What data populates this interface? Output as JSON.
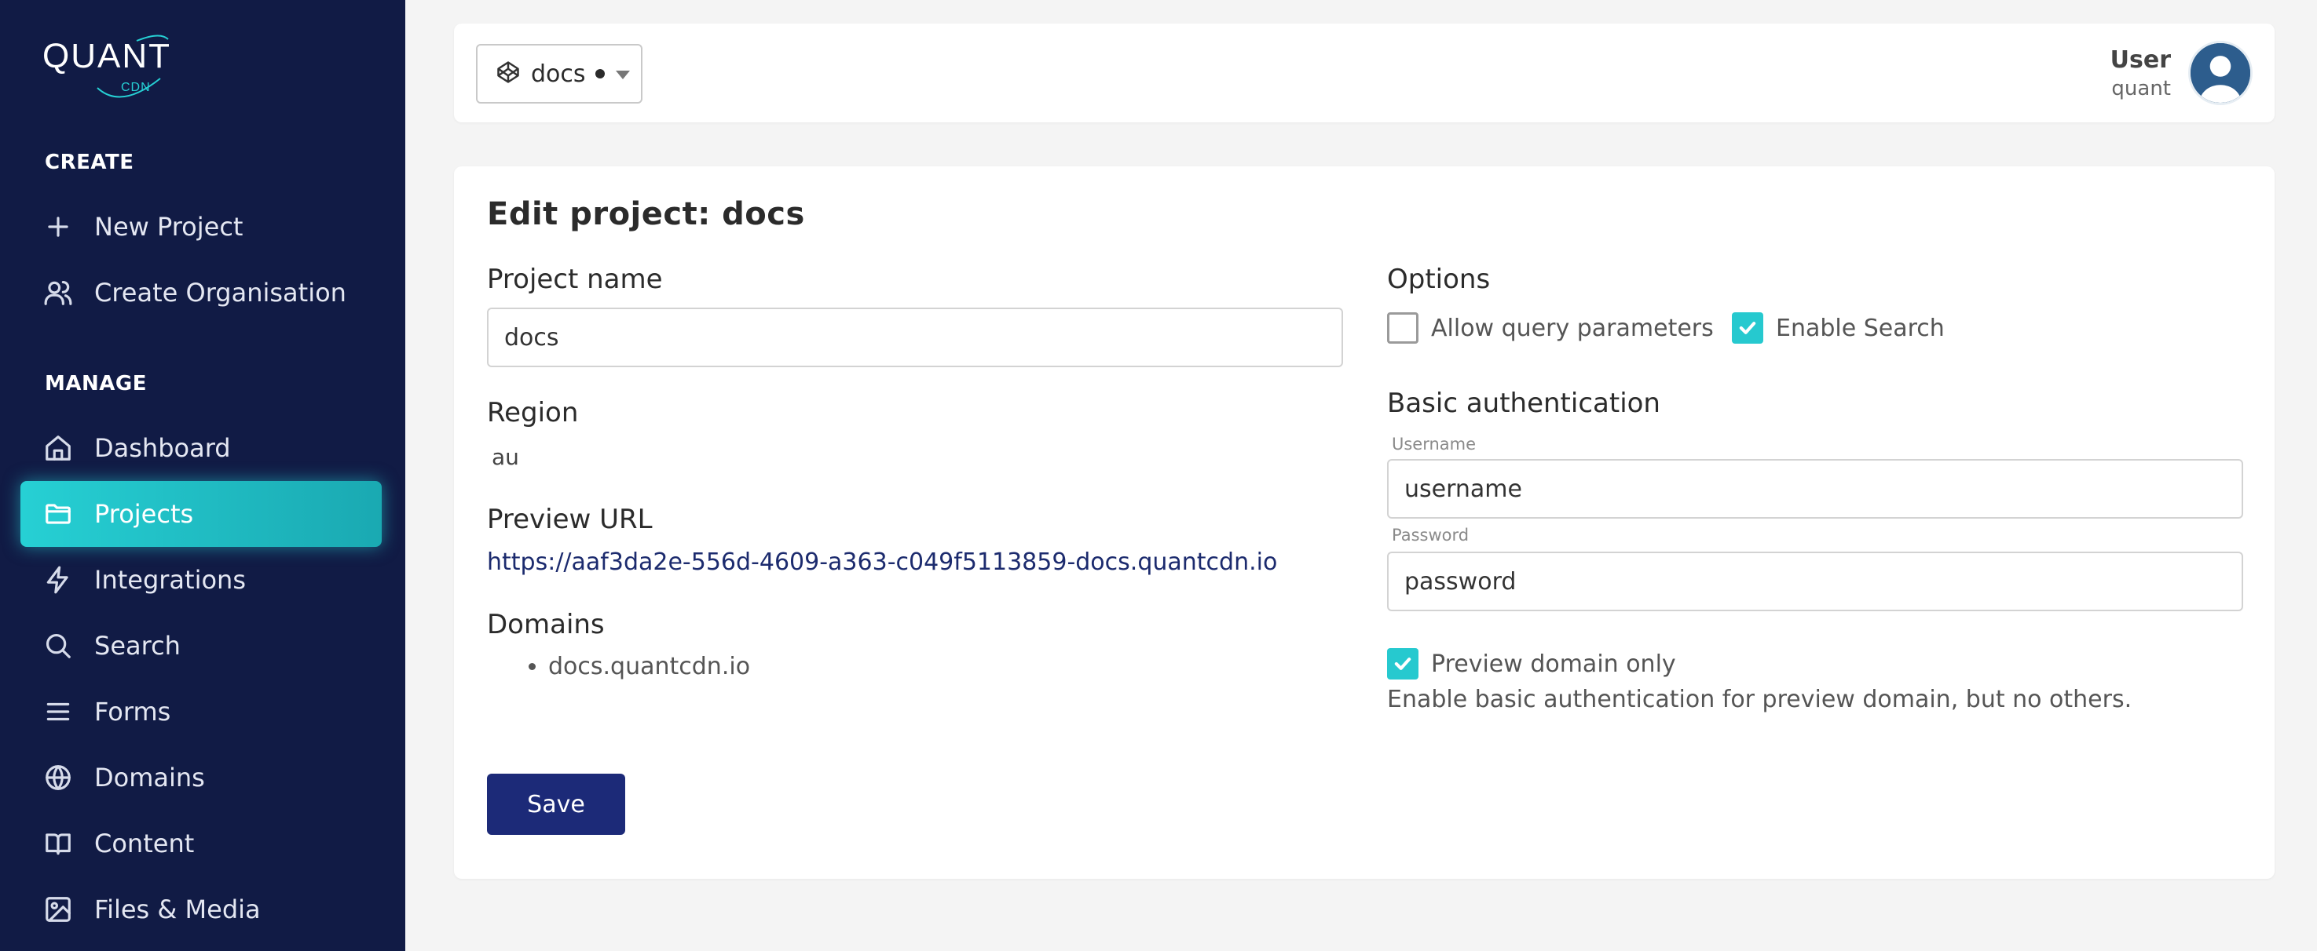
{
  "sidebar": {
    "logo_text": "QUANT",
    "logo_sub": "CDN",
    "create_label": "CREATE",
    "create_items": [
      {
        "label": "New Project",
        "icon": "plus-icon"
      },
      {
        "label": "Create Organisation",
        "icon": "users-icon"
      }
    ],
    "manage_label": "MANAGE",
    "manage_items": [
      {
        "label": "Dashboard",
        "icon": "home-icon"
      },
      {
        "label": "Projects",
        "icon": "folder-icon",
        "active": true
      },
      {
        "label": "Integrations",
        "icon": "lightning-icon"
      },
      {
        "label": "Search",
        "icon": "search-icon"
      },
      {
        "label": "Forms",
        "icon": "menu-icon"
      },
      {
        "label": "Domains",
        "icon": "globe-icon"
      },
      {
        "label": "Content",
        "icon": "book-icon"
      },
      {
        "label": "Files & Media",
        "icon": "image-icon"
      }
    ]
  },
  "header": {
    "project_selector": {
      "value": "docs"
    },
    "user": {
      "name": "User",
      "org": "quant"
    }
  },
  "form": {
    "title": "Edit project: docs",
    "project_name_label": "Project name",
    "project_name_value": "docs",
    "region_label": "Region",
    "region_value": "au",
    "preview_url_label": "Preview URL",
    "preview_url": "https://aaf3da2e-556d-4609-a363-c049f5113859-docs.quantcdn.io",
    "domains_label": "Domains",
    "domains": [
      "docs.quantcdn.io"
    ],
    "save_label": "Save",
    "options_label": "Options",
    "allow_query_label": "Allow query parameters",
    "allow_query_checked": false,
    "enable_search_label": "Enable Search",
    "enable_search_checked": true,
    "basic_auth_label": "Basic authentication",
    "username_label": "Username",
    "username_value": "username",
    "password_label": "Password",
    "password_value": "password",
    "preview_only_label": "Preview domain only",
    "preview_only_checked": true,
    "preview_only_help": "Enable basic authentication for preview domain, but no others."
  },
  "colors": {
    "sidebar_bg": "#111b45",
    "accent": "#26d0d4",
    "primary_button": "#1c2a78",
    "page_bg": "#f4f4f4"
  }
}
